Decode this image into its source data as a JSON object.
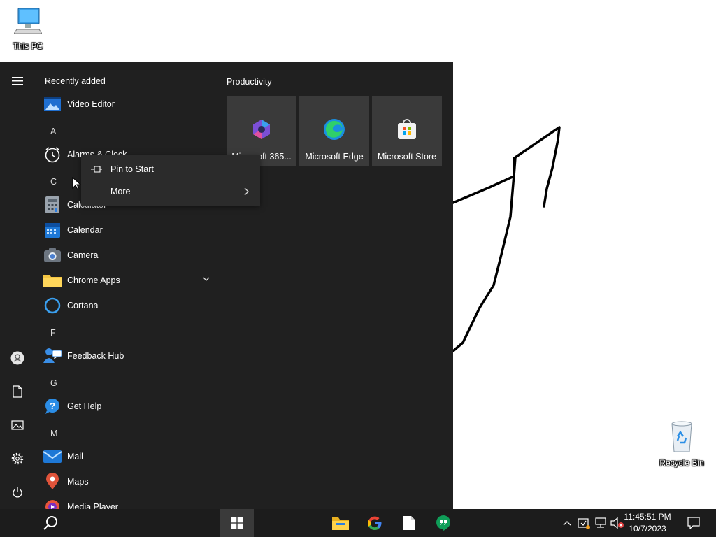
{
  "desktop": {
    "this_pc_label": "This PC",
    "recycle_bin_label": "Recycle Bin"
  },
  "start_menu": {
    "recently_added_title": "Recently added",
    "apps": {
      "video_editor": "Video Editor",
      "letter_a": "A",
      "alarms": "Alarms & Clock",
      "letter_c": "C",
      "calculator": "Calculator",
      "calendar": "Calendar",
      "camera": "Camera",
      "chrome_apps": "Chrome Apps",
      "cortana": "Cortana",
      "letter_f": "F",
      "feedback_hub": "Feedback Hub",
      "letter_g": "G",
      "get_help": "Get Help",
      "letter_m": "M",
      "mail": "Mail",
      "maps": "Maps",
      "media_player": "Media Player"
    },
    "tiles_title": "Productivity",
    "tiles": [
      {
        "label": "Microsoft 365..."
      },
      {
        "label": "Microsoft Edge"
      },
      {
        "label": "Microsoft Store"
      }
    ]
  },
  "context_menu": {
    "pin_to_start": "Pin to Start",
    "more": "More"
  },
  "taskbar": {
    "time": "11:45:51 PM",
    "date": "10/7/2023"
  },
  "colors": {
    "start_bg": "#202020",
    "tile_bg": "#3a3a3a",
    "taskbar_bg": "#1c1c1c",
    "context_bg": "#2b2b2b"
  }
}
